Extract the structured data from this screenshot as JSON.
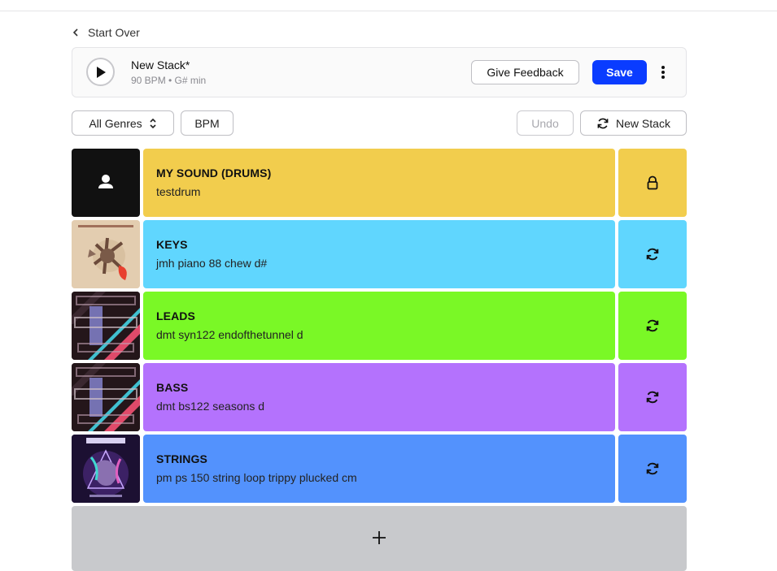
{
  "nav": {
    "back_label": "Start Over"
  },
  "player": {
    "title": "New Stack*",
    "meta": "90 BPM • G# min",
    "feedback_label": "Give Feedback",
    "save_label": "Save"
  },
  "filters": {
    "genre_label": "All Genres",
    "bpm_label": "BPM",
    "undo_label": "Undo",
    "new_stack_label": "New Stack"
  },
  "layers": [
    {
      "category": "MY SOUND (DRUMS)",
      "name": "testdrum",
      "color": "#f2cd4d",
      "action": "lock-icon"
    },
    {
      "category": "KEYS",
      "name": "jmh piano 88 chew d#",
      "color": "#60d6fe",
      "action": "refresh-icon"
    },
    {
      "category": "LEADS",
      "name": "dmt syn122 endofthetunnel d",
      "color": "#7af826",
      "action": "refresh-icon"
    },
    {
      "category": "BASS",
      "name": "dmt bs122 seasons d",
      "color": "#b472fd",
      "action": "refresh-icon"
    },
    {
      "category": "STRINGS",
      "name": "pm ps 150 string loop trippy plucked cm",
      "color": "#5392fd",
      "action": "refresh-icon"
    }
  ],
  "colors": {
    "accent": "#0a3cff",
    "add_row": "#c8c9cc"
  }
}
